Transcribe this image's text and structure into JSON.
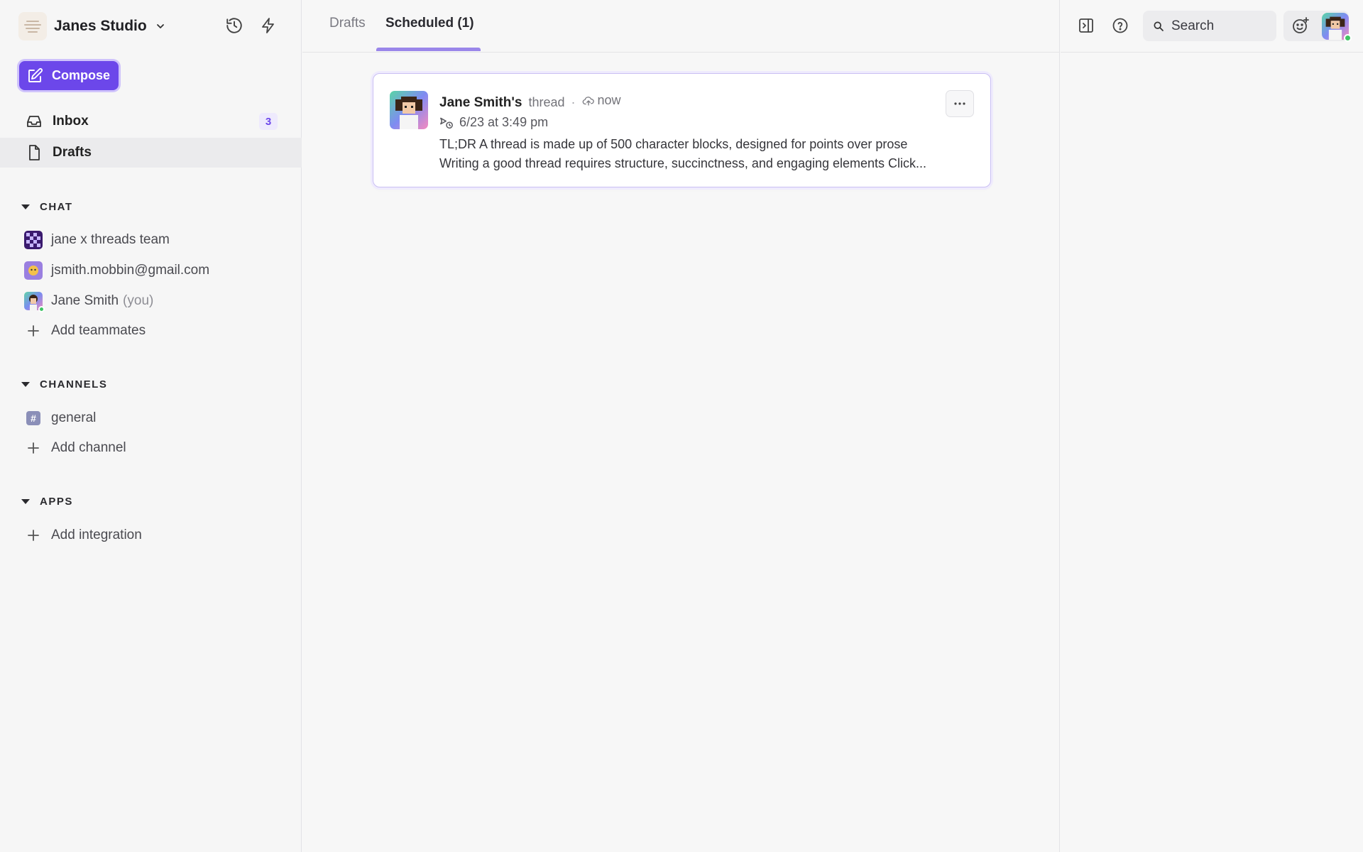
{
  "workspace": {
    "name": "Janes Studio"
  },
  "compose": {
    "label": "Compose"
  },
  "nav": {
    "inbox": {
      "label": "Inbox",
      "count": "3"
    },
    "drafts": {
      "label": "Drafts"
    }
  },
  "chat": {
    "title": "CHAT",
    "items": [
      {
        "label": "jane x threads team"
      },
      {
        "label": "jsmith.mobbin@gmail.com"
      },
      {
        "label": "Jane Smith",
        "suffix": "(you)"
      }
    ],
    "add": "Add teammates"
  },
  "channels": {
    "title": "CHANNELS",
    "items": [
      {
        "label": "general"
      }
    ],
    "add": "Add channel"
  },
  "apps": {
    "title": "APPS",
    "add": "Add integration"
  },
  "tabs": [
    {
      "label": "Drafts",
      "active": false
    },
    {
      "label": "Scheduled (1)",
      "active": true
    }
  ],
  "card": {
    "author": "Jane Smith's",
    "kind": "thread",
    "separator": "·",
    "status": "now",
    "scheduled": "6/23 at 3:49 pm",
    "line1": "TL;DR A thread is made up of 500 character blocks, designed for points over prose",
    "line2": "Writing a good thread requires structure, succinctness, and engaging elements Click..."
  },
  "search": {
    "placeholder": "Search"
  },
  "colors": {
    "accent": "#6c47ea",
    "badge_bg": "#eeeafd",
    "online": "#3ec464"
  }
}
